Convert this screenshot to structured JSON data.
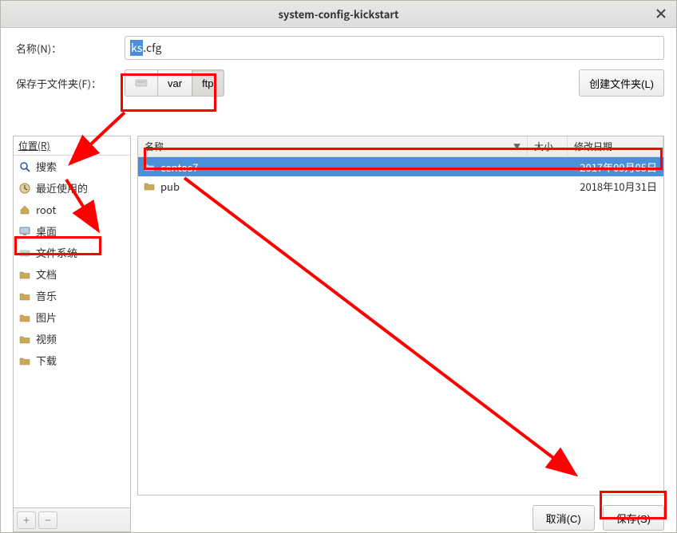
{
  "window": {
    "title": "system-config-kickstart"
  },
  "name_row": {
    "label": "名称(N)：",
    "value_sel": "ks",
    "value_rest": ".cfg"
  },
  "path_row": {
    "label": "保存于文件夹(F)：",
    "segments": [
      "",
      "var",
      "ftp"
    ],
    "create_folder": "创建文件夹(L)"
  },
  "sidebar": {
    "header": "位置(R)",
    "items": [
      {
        "icon": "search",
        "label": "搜索"
      },
      {
        "icon": "clock",
        "label": "最近使用的"
      },
      {
        "icon": "home",
        "label": "root"
      },
      {
        "icon": "desktop",
        "label": "桌面"
      },
      {
        "icon": "disk",
        "label": "文件系统"
      },
      {
        "icon": "folder",
        "label": "文档"
      },
      {
        "icon": "folder",
        "label": "音乐"
      },
      {
        "icon": "folder",
        "label": "图片"
      },
      {
        "icon": "folder",
        "label": "视频"
      },
      {
        "icon": "folder",
        "label": "下载"
      }
    ]
  },
  "filelist": {
    "columns": {
      "name": "名称",
      "size": "大小",
      "date": "修改日期"
    },
    "rows": [
      {
        "name": "centos7",
        "size": "",
        "date": "2017年09月05日",
        "selected": true
      },
      {
        "name": "pub",
        "size": "",
        "date": "2018年10月31日",
        "selected": false
      }
    ]
  },
  "buttons": {
    "cancel": "取消(C)",
    "save": "保存(S)"
  }
}
